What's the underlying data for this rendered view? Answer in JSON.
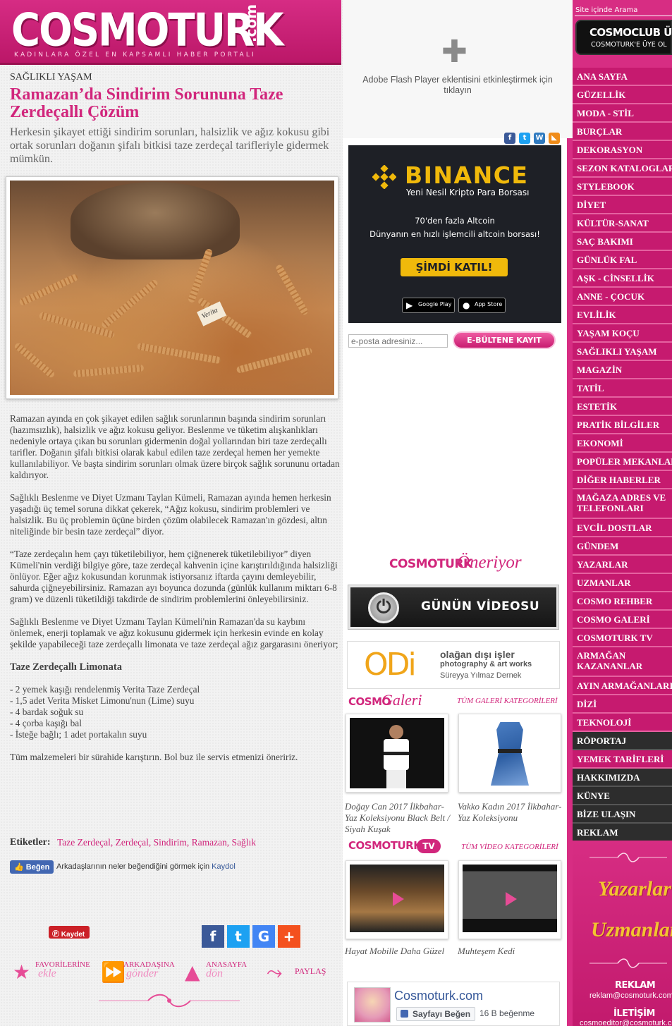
{
  "brand": {
    "logo_text": "COSMOTURK",
    "logo_suffix": ".com",
    "tagline": "KADINLARA ÖZEL EN KAPSAMLI HABER PORTALI"
  },
  "article": {
    "category": "SAĞLIKLI YAŞAM",
    "title": "Ramazan’da Sindirim Sorununa Taze Zerdeçallı Çözüm",
    "lead": "Herkesin şikayet ettiği sindirim sorunları, halsizlik ve ağız kokusu gibi ortak sorunları doğanın şifalı bitkisi taze zerdeçal tarifleriyle gidermek mümkün.",
    "photo_label": "Verita",
    "paragraphs": [
      "Ramazan ayında en çok şikayet edilen sağlık sorunlarının başında sindirim sorunları (hazımsızlık), halsizlik ve ağız kokusu geliyor. Beslenme ve tüketim alışkanlıkları nedeniyle ortaya çıkan bu sorunları gidermenin doğal yollarından biri taze zerdeçallı tarifler. Doğanın şifalı bitkisi olarak kabul edilen taze zerdeçal hemen her yemekte kullanılabiliyor. Ve başta sindirim sorunları olmak üzere birçok sağlık sorununu ortadan kaldırıyor.",
      "Sağlıklı Beslenme ve Diyet Uzmanı Taylan Kümeli, Ramazan ayında hemen herkesin yaşadığı üç temel soruna dikkat çekerek, “Ağız kokusu, sindirim problemleri ve halsizlik. Bu üç problemin üçüne birden çözüm olabilecek Ramazan'ın gözdesi, altın niteliğinde bir besin taze zerdeçal” diyor.",
      "“Taze zerdeçalın hem çayı tüketilebiliyor, hem çiğnenerek tüketilebiliyor” diyen Kümeli'nin verdiği bilgiye göre, taze zerdeçal kahvenin içine karıştırıldığında halsizliği önlüyor. Eğer ağız kokusundan korunmak istiyorsanız iftarda çayını demleyebilir, sahurda çiğneyebilirsiniz. Ramazan ayı boyunca dozunda (günlük kullanım miktarı 6-8 gram) ve düzenli tüketildiği takdirde de sindirim problemlerini önleyebilirsiniz.",
      "Sağlıklı Beslenme ve Diyet Uzmanı Taylan Kümeli'nin Ramazan'da su kaybını önlemek, enerji toplamak ve ağız kokusunu gidermek için herkesin evinde en kolay şekilde yapabileceği taze zerdeçallı limonata ve taze zerdeçal ağız gargarasını öneriyor;"
    ],
    "recipe_title": "Taze Zerdeçallı Limonata",
    "ingredients": [
      "- 2 yemek kaşığı rendelenmiş Verita Taze Zerdeçal",
      "- 1,5 adet Verita Misket Limonu'nun (Lime) suyu",
      "- 4 bardak soğuk su",
      "- 4 çorba kaşığı bal",
      "- İsteğe bağlı; 1 adet portakalın suyu"
    ],
    "closing": "Tüm malzemeleri bir sürahide karıştırın. Bol buz ile servis etmenizi öneririz.",
    "tags_label": "Etiketler:",
    "tags": "Taze Zerdeçal, Zerdeçal, Sindirim, Ramazan, Sağlık"
  },
  "social": {
    "fb_like": "Beğen",
    "fb_like_text": "Arkadaşlarının neler beğendiğini görmek için",
    "fb_like_link": "Kaydol",
    "pin": "Kaydet",
    "facebook": "f",
    "twitter": "t",
    "google": "G",
    "plus": "+",
    "favorite_top": "FAVORİLERİNE",
    "favorite_bottom": "ekle",
    "send_top": "ARKADAŞINA",
    "send_bottom": "gönder",
    "home_top": "ANASAYFA",
    "home_bottom": "dön",
    "share": "PAYLAŞ"
  },
  "flash": {
    "message": "Adobe Flash Player eklentisini etkinleştirmek için tıklayın"
  },
  "ad_binance": {
    "logo": "BINANCE",
    "tagline": "Yeni Nesil Kripto Para Borsası",
    "line1": "70'den fazla Altcoin",
    "line2": "Dünyanın en hızlı işlemcili altcoin borsası!",
    "cta": "ŞİMDİ KATIL!",
    "google_play": "Google Play",
    "app_store": "App Store"
  },
  "newsletter": {
    "placeholder": "e-posta adresiniz...",
    "button": "E-BÜLTENE KAYIT OLUN"
  },
  "recommend": {
    "brand": "COSMOTURK",
    "script": "Öneriyor"
  },
  "video_of_day": {
    "label": "GÜNÜN VİDEOSU"
  },
  "odi_ad": {
    "logo": "ODi",
    "line1": "olağan dışı işler",
    "line2": "photography & art works",
    "line3": "Süreyya Yılmaz Dernek"
  },
  "gallery": {
    "brand": "COSMO",
    "script": "Galeri",
    "all_link": "TÜM GALERİ KATEGORİLERİ",
    "items": [
      {
        "caption": "Doğay Can 2017 İlkbahar-Yaz Koleksiyonu Black Belt / Siyah Kuşak"
      },
      {
        "caption": "Vakko Kadın 2017 İlkbahar-Yaz Koleksiyonu"
      }
    ]
  },
  "tv": {
    "brand": "COSMOTURK",
    "badge": "TV",
    "all_link": "TÜM VİDEO KATEGORİLERİ",
    "items": [
      {
        "caption": "Hayat Mobille Daha Güzel"
      },
      {
        "caption": "Muhteşem Kedi"
      }
    ]
  },
  "fb_page": {
    "name": "Cosmoturk.com",
    "like_button": "Sayfayı Beğen",
    "likes": "16 B beğenme"
  },
  "sidebar": {
    "search_label": "Site içinde Arama",
    "club_title": "COSMOCLUB ÜYESİ",
    "club_sub": "COSMOTURK'E ÜYE OL",
    "nav": [
      "ANA SAYFA",
      "GÜZELLİK",
      "MODA - STİL",
      "BURÇLAR",
      "DEKORASYON",
      "SEZON KATALOGLARI",
      "STYLEBOOK",
      "DİYET",
      "KÜLTÜR-SANAT",
      "SAÇ BAKIMI",
      "GÜNLÜK FAL",
      "AŞK - CİNSELLİK",
      "ANNE - ÇOCUK",
      "EVLİLİK",
      "YAŞAM KOÇU",
      "SAĞLIKLI YAŞAM",
      "MAGAZİN",
      "TATİL",
      "ESTETİK",
      "PRATİK BİLGİLER",
      "EKONOMİ",
      "POPÜLER MEKANLAR",
      "DİĞER HABERLER",
      "MAĞAZA ADRES VE TELEFONLARI",
      "EVCİL DOSTLAR",
      "GÜNDEM",
      "YAZARLAR",
      "UZMANLAR",
      "COSMO REHBER",
      "COSMO GALERİ",
      "COSMOTURK TV",
      "ARMAĞAN KAZANANLAR",
      "AYIN ARMAĞANLARI",
      "DİZİ",
      "TEKNOLOJİ",
      "RÖPORTAJ",
      "YEMEK TARİFLERİ",
      "HAKKIMIZDA",
      "KÜNYE",
      "BİZE ULAŞIN",
      "REKLAM"
    ],
    "yazarlar": "Yazarlar",
    "uzmanlar": "Uzmanlar",
    "reklam_label": "REKLAM",
    "reklam_mail": "reklam@cosmoturk.com",
    "iletisim_label": "İLETİŞİM",
    "iletisim_mail": "cosmoeditor@cosmoturk.com"
  },
  "colors": {
    "brand_pink": "#d72d83",
    "title_pink": "#d1267c",
    "binance_yellow": "#f0b90b",
    "facebook_blue": "#4267b2"
  }
}
